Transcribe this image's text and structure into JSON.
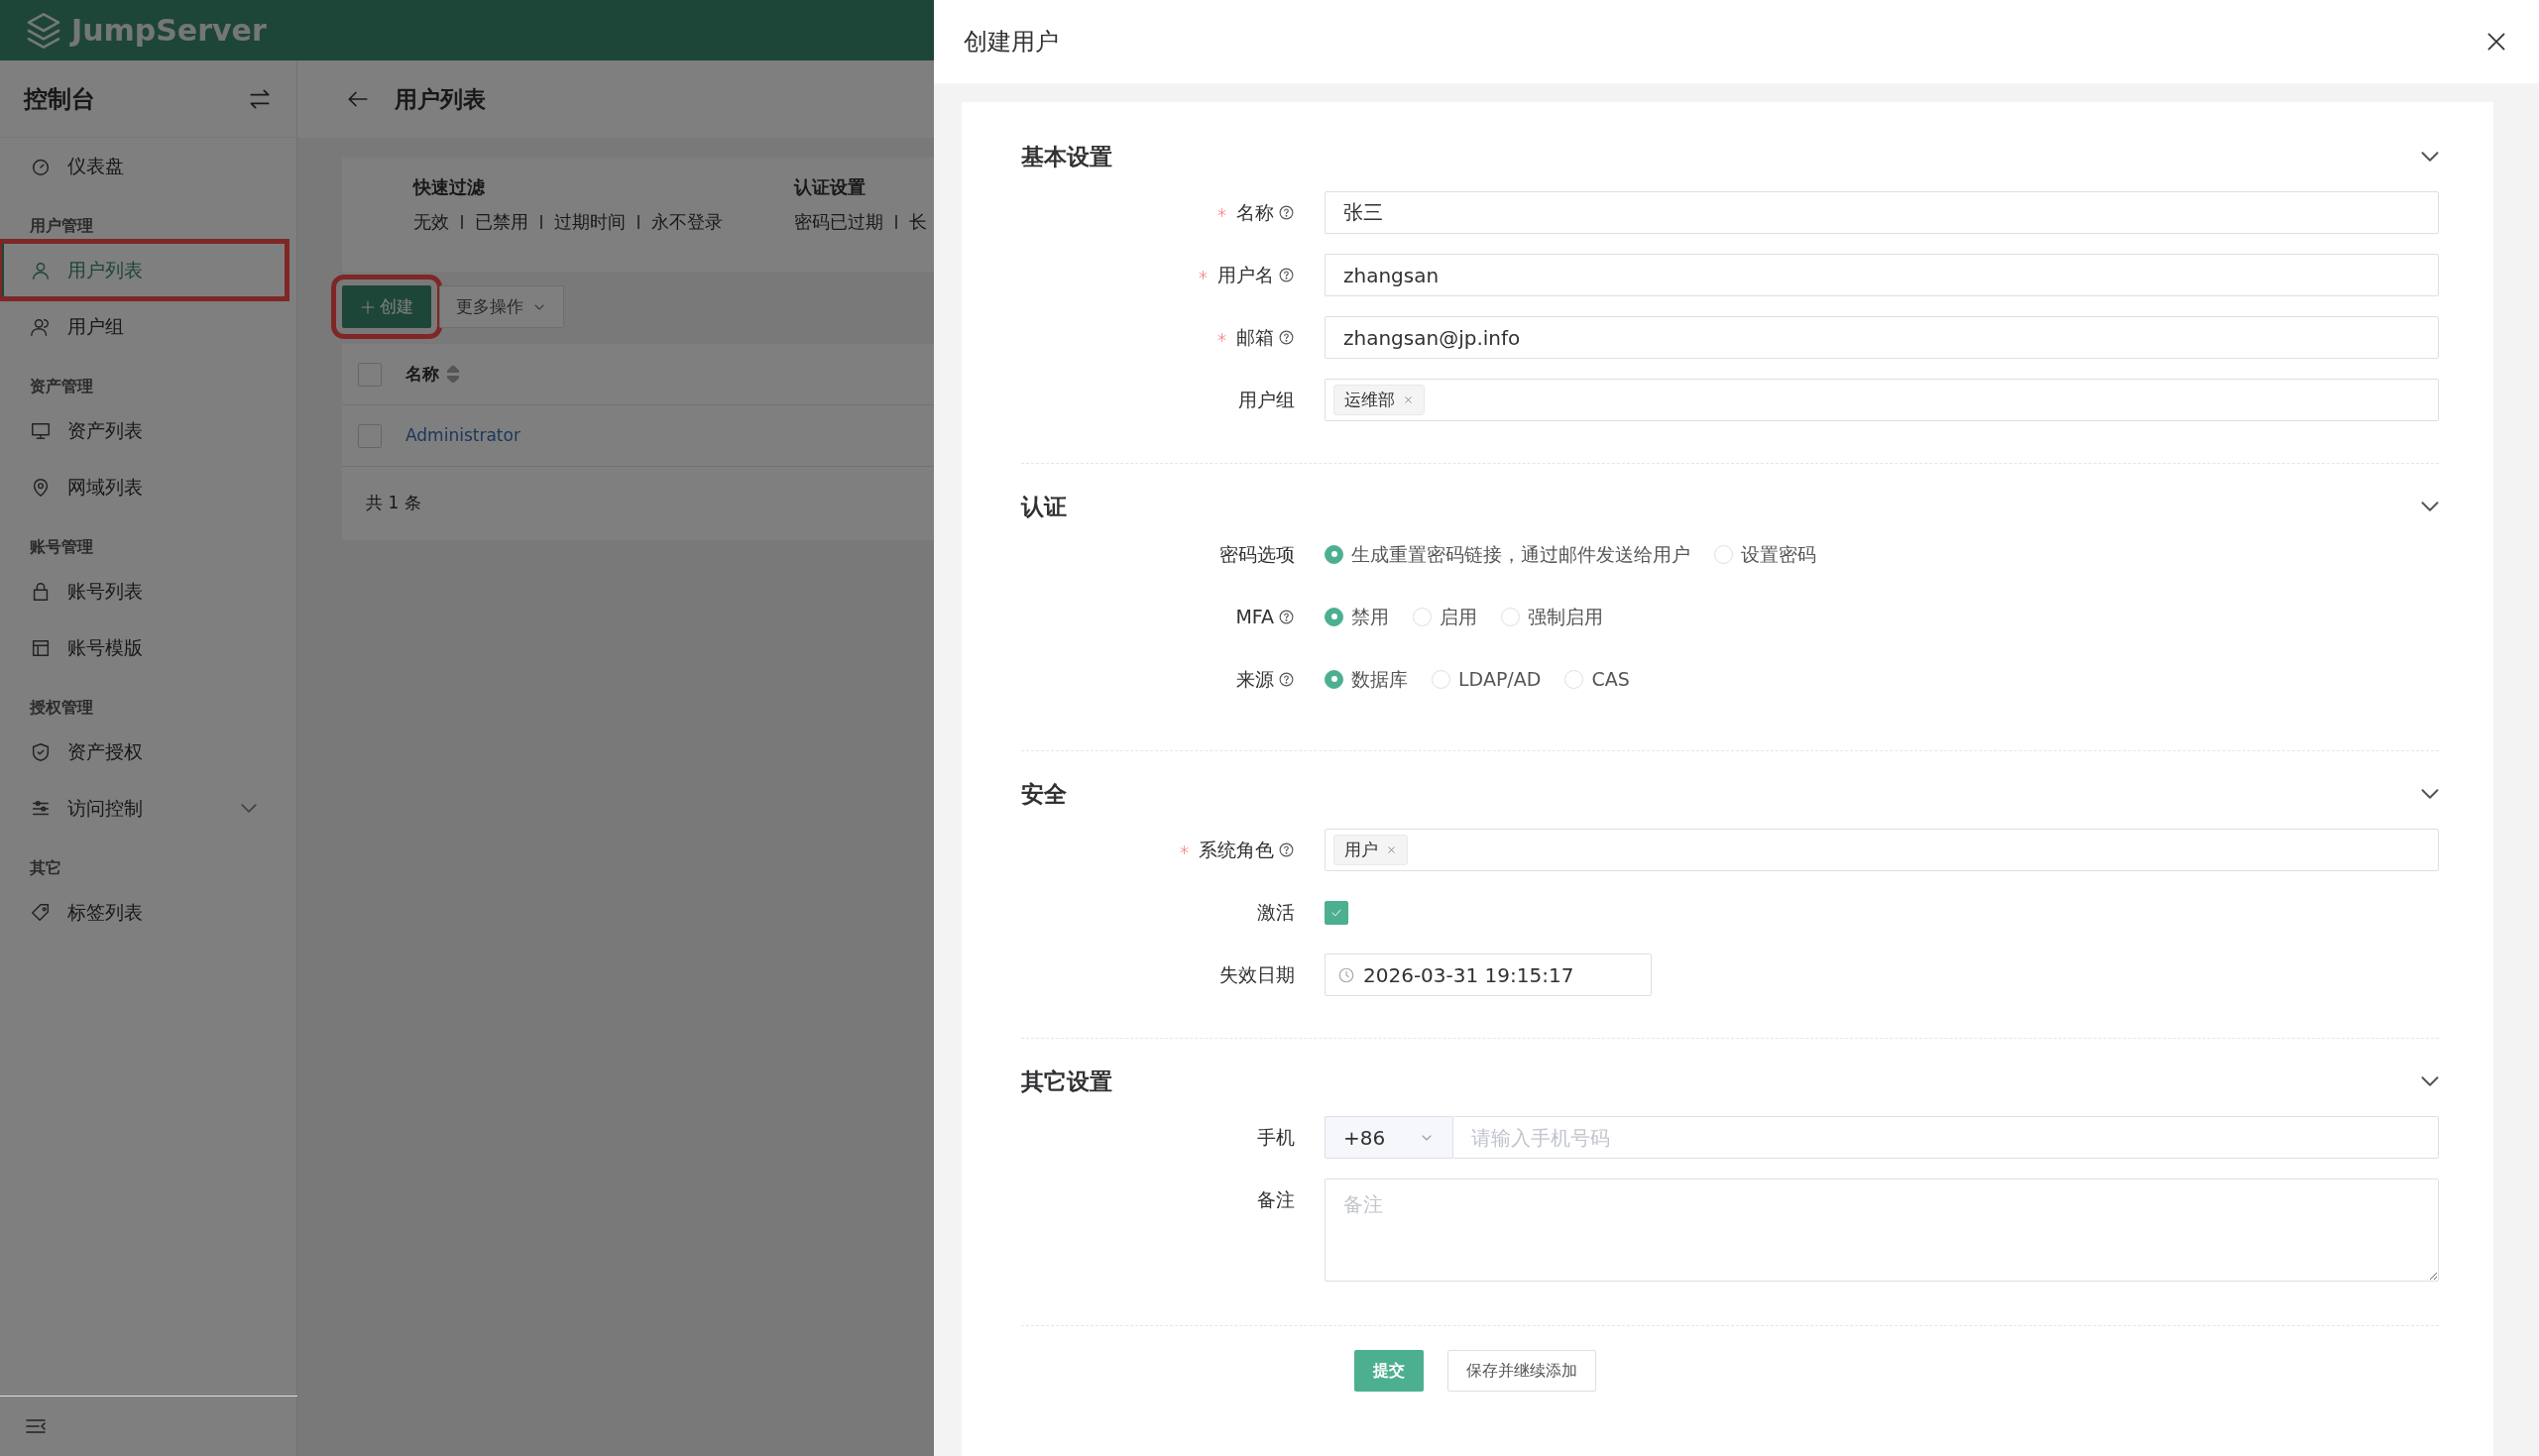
{
  "brand": {
    "name": "JumpServer"
  },
  "sidebar": {
    "title": "控制台",
    "items": [
      {
        "kind": "item",
        "label": "仪表盘",
        "selected": false,
        "highlighted": false
      },
      {
        "kind": "heading",
        "label": "用户管理"
      },
      {
        "kind": "item",
        "label": "用户列表",
        "selected": true,
        "highlighted": true
      },
      {
        "kind": "item",
        "label": "用户组",
        "selected": false,
        "highlighted": false
      },
      {
        "kind": "heading",
        "label": "资产管理"
      },
      {
        "kind": "item",
        "label": "资产列表",
        "selected": false,
        "highlighted": false
      },
      {
        "kind": "item",
        "label": "网域列表",
        "selected": false,
        "highlighted": false
      },
      {
        "kind": "heading",
        "label": "账号管理"
      },
      {
        "kind": "item",
        "label": "账号列表",
        "selected": false,
        "highlighted": false
      },
      {
        "kind": "item",
        "label": "账号模版",
        "selected": false,
        "highlighted": false
      },
      {
        "kind": "heading",
        "label": "授权管理"
      },
      {
        "kind": "item",
        "label": "资产授权",
        "selected": false,
        "highlighted": false
      },
      {
        "kind": "group",
        "label": "访问控制",
        "selected": false,
        "highlighted": false,
        "expanded": false
      },
      {
        "kind": "heading",
        "label": "其它"
      },
      {
        "kind": "item",
        "label": "标签列表",
        "selected": false,
        "highlighted": false
      }
    ]
  },
  "page": {
    "title": "用户列表",
    "filters": [
      {
        "title": "快速过滤",
        "options": [
          "无效",
          "已禁用",
          "过期时间",
          "永不登录"
        ]
      },
      {
        "title": "认证设置",
        "options": [
          "密码已过期",
          "长"
        ]
      }
    ],
    "actions": [
      {
        "kind": "primary",
        "label": "创建",
        "highlighted": true
      },
      {
        "kind": "dropdown",
        "label": "更多操作",
        "highlighted": false
      }
    ],
    "table": {
      "select_all_checked": false,
      "columns": [
        {
          "label": "名称",
          "sortable": true
        }
      ],
      "rows": [
        {
          "name": "Administrator",
          "checked": false
        }
      ]
    },
    "total": "共 1 条"
  },
  "drawer": {
    "title": "创建用户",
    "sections": [
      {
        "title": "基本设置",
        "expanded": true,
        "fields": [
          {
            "kind": "text",
            "label": "名称",
            "required": true,
            "help": true,
            "value": "张三"
          },
          {
            "kind": "text",
            "label": "用户名",
            "required": true,
            "help": true,
            "value": "zhangsan"
          },
          {
            "kind": "text",
            "label": "邮箱",
            "required": true,
            "help": true,
            "value": "zhangsan@jp.info"
          },
          {
            "kind": "tags",
            "label": "用户组",
            "required": false,
            "help": false,
            "tags": [
              "运维部"
            ]
          }
        ]
      },
      {
        "title": "认证",
        "expanded": true,
        "fields": [
          {
            "kind": "radio",
            "label": "密码选项",
            "required": false,
            "help": false,
            "options": [
              {
                "label": "生成重置密码链接，通过邮件发送给用户",
                "selected": true
              },
              {
                "label": "设置密码",
                "selected": false
              }
            ]
          },
          {
            "kind": "radio",
            "label": "MFA",
            "required": false,
            "help": true,
            "options": [
              {
                "label": "禁用",
                "selected": true
              },
              {
                "label": "启用",
                "selected": false
              },
              {
                "label": "强制启用",
                "selected": false
              }
            ]
          },
          {
            "kind": "radio",
            "label": "来源",
            "required": false,
            "help": true,
            "options": [
              {
                "label": "数据库",
                "selected": true
              },
              {
                "label": "LDAP/AD",
                "selected": false
              },
              {
                "label": "CAS",
                "selected": false
              }
            ]
          }
        ]
      },
      {
        "title": "安全",
        "expanded": true,
        "fields": [
          {
            "kind": "tags",
            "label": "系统角色",
            "required": true,
            "help": true,
            "tags": [
              "用户"
            ]
          },
          {
            "kind": "checkbox",
            "label": "激活",
            "required": false,
            "help": false,
            "checked": true
          },
          {
            "kind": "date",
            "label": "失效日期",
            "required": false,
            "help": false,
            "value": "2026-03-31 19:15:17"
          }
        ]
      },
      {
        "title": "其它设置",
        "expanded": true,
        "fields": [
          {
            "kind": "phone",
            "label": "手机",
            "required": false,
            "help": false,
            "code": "+86",
            "placeholder": "请输入手机号码"
          },
          {
            "kind": "textarea",
            "label": "备注",
            "required": false,
            "help": false,
            "placeholder": "备注"
          }
        ]
      }
    ],
    "buttons": [
      {
        "kind": "primary",
        "label": "提交"
      },
      {
        "kind": "default",
        "label": "保存并继续添加"
      }
    ]
  }
}
